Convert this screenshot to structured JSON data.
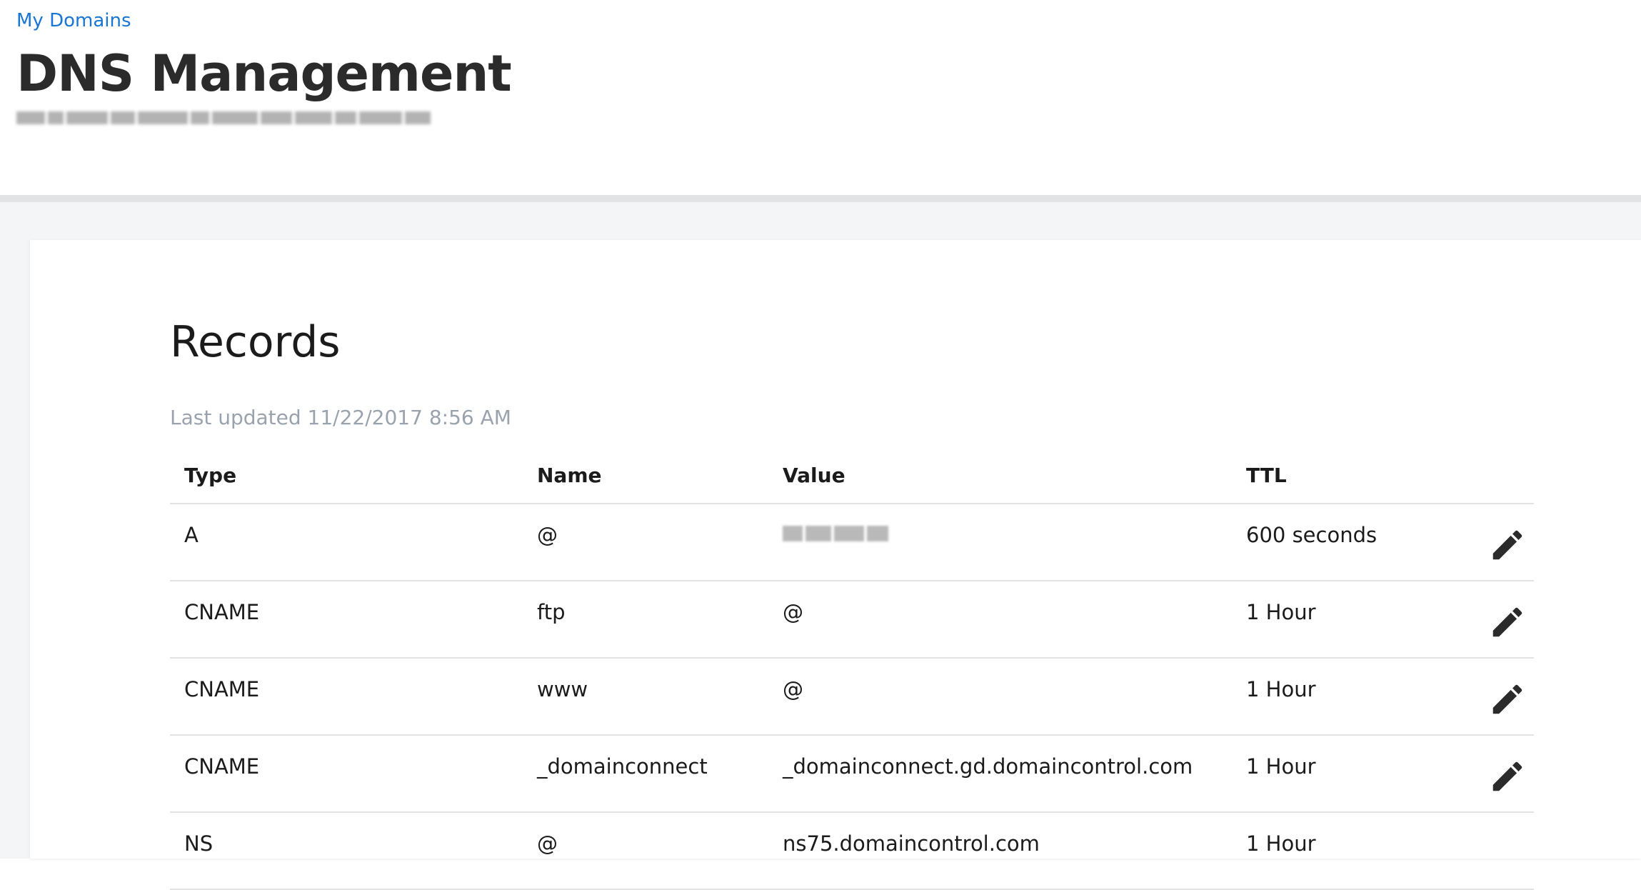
{
  "breadcrumb": {
    "label": "My Domains"
  },
  "header": {
    "title": "DNS Management"
  },
  "records": {
    "title": "Records",
    "last_updated": "Last updated 11/22/2017 8:56 AM",
    "columns": [
      "Type",
      "Name",
      "Value",
      "TTL"
    ],
    "rows": [
      {
        "type": "A",
        "name": "@",
        "value": "",
        "ttl": "600 seconds"
      },
      {
        "type": "CNAME",
        "name": "ftp",
        "value": "@",
        "ttl": "1 Hour"
      },
      {
        "type": "CNAME",
        "name": "www",
        "value": "@",
        "ttl": "1 Hour"
      },
      {
        "type": "CNAME",
        "name": "_domainconnect",
        "value": "_domainconnect.gd.domaincontrol.com",
        "ttl": "1 Hour"
      },
      {
        "type": "NS",
        "name": "@",
        "value": "ns75.domaincontrol.com",
        "ttl": "1 Hour"
      }
    ]
  },
  "icons": {
    "edit": "pencil-icon"
  },
  "colors": {
    "link": "#1976d2",
    "muted_text": "#9aa3ad",
    "background_gray": "#f4f5f6"
  }
}
